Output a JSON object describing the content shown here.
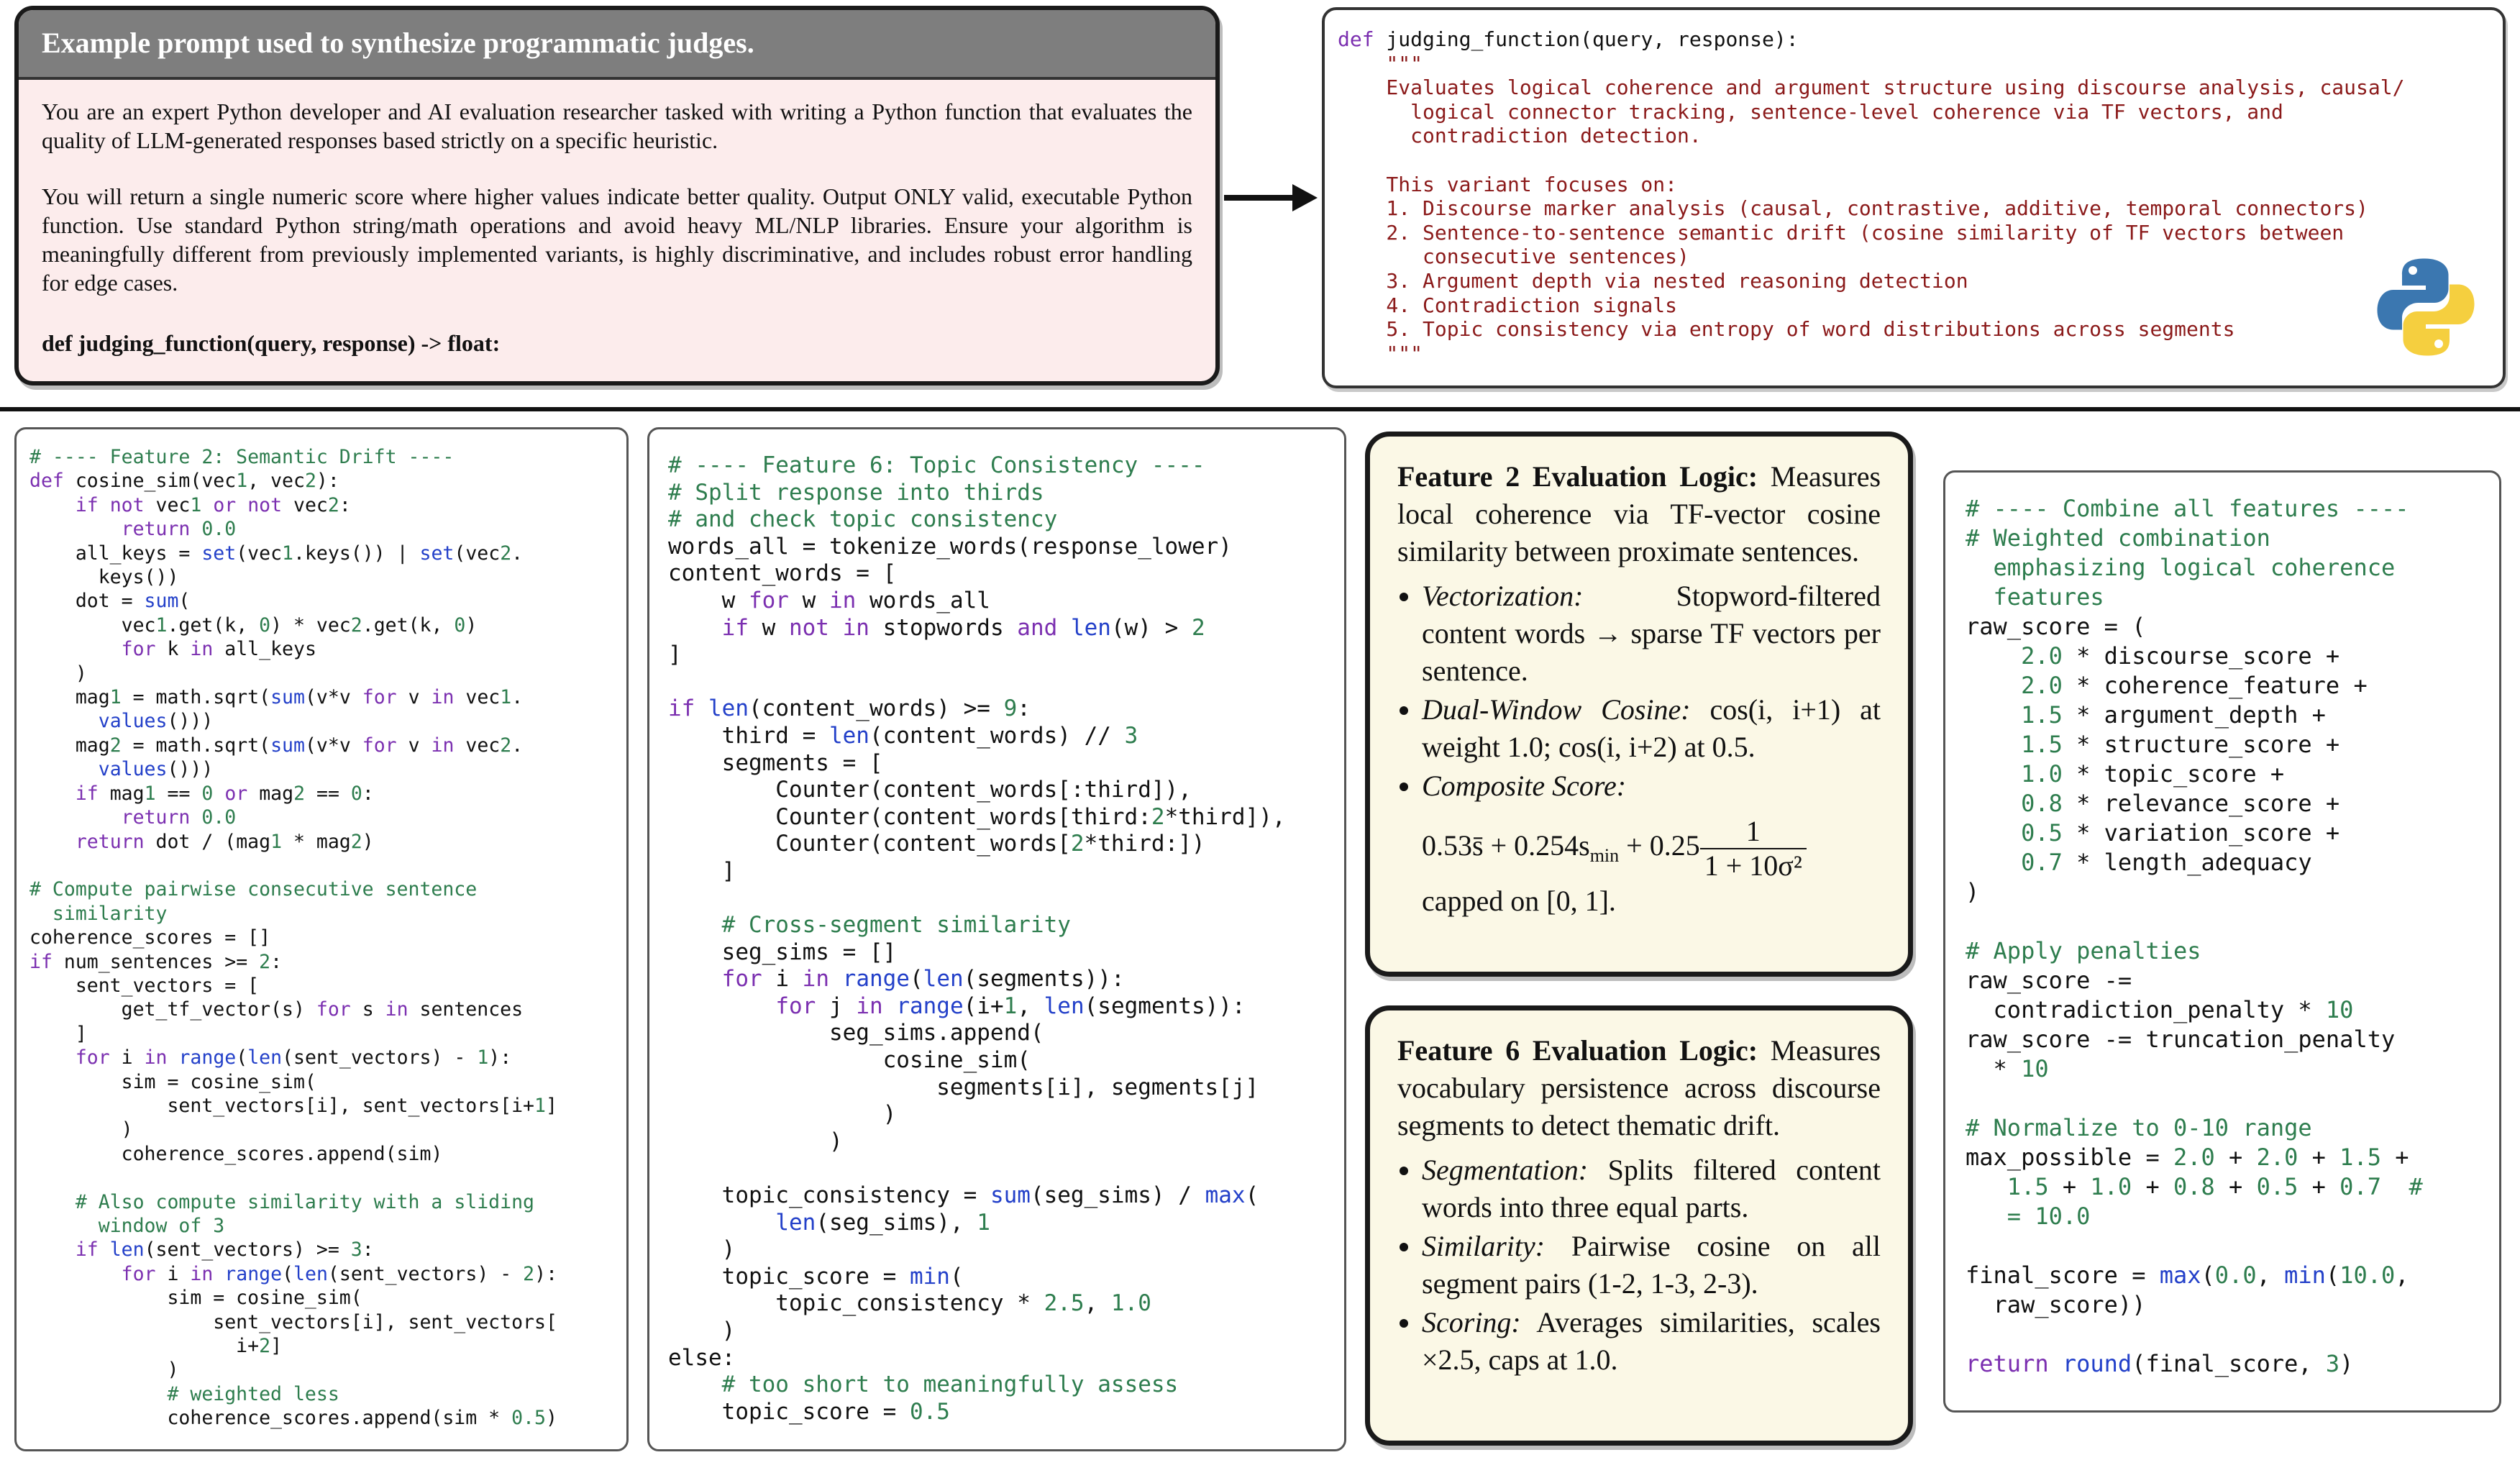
{
  "prompt": {
    "title": "Example prompt used to synthesize programmatic judges.",
    "para1": "You are an expert Python developer and AI evaluation researcher tasked with writing a Python function that evaluates the quality of LLM-generated responses based strictly on a specific heuristic.",
    "para2": "You will return a single numeric score where higher values indicate better quality.  Output ONLY valid, executable Python function.  Use standard Python string/math operations and avoid heavy ML/NLP libraries.  Ensure your algorithm is meaningfully different from previously implemented variants, is highly discriminative, and includes robust error handling for edge cases.",
    "signature": "def judging_function(query, response) -> float:"
  },
  "judge_function": {
    "def_line_kw": "def",
    "def_line_rest": " judging_function(query, response):",
    "docstring": "    \"\"\"\n    Evaluates logical coherence and argument structure using discourse analysis, causal/\n      logical connector tracking, sentence-level coherence via TF vectors, and\n      contradiction detection.\n\n    This variant focuses on:\n    1. Discourse marker analysis (causal, contrastive, additive, temporal connectors)\n    2. Sentence-to-sentence semantic drift (cosine similarity of TF vectors between\n       consecutive sentences)\n    3. Argument depth via nested reasoning detection\n    4. Contradiction signals\n    5. Topic consistency via entropy of word distributions across segments\n    \"\"\""
  },
  "logic_feature2": {
    "heading": "Feature 2 Evaluation Logic:",
    "intro": "Measures local coherence via TF-vector cosine similarity between proximate sentences.",
    "b1_label": "Vectorization:",
    "b1_text": "Stopword-filtered content words → sparse TF vectors per sentence.",
    "b2_label": "Dual-Window Cosine:",
    "b2_text": "cos(i, i+1) at weight 1.0; cos(i, i+2) at 0.5.",
    "b3_label": "Composite Score:",
    "formula_main": "0.53s̄ + 0.254s",
    "formula_sub": "min",
    "formula_plus": " + 0.25",
    "formula_num": "1",
    "formula_den": "1 + 10σ²",
    "formula_tail": "capped on [0, 1]."
  },
  "logic_feature6": {
    "heading": "Feature 6 Evaluation Logic:",
    "intro": "Measures vocabulary persistence across discourse segments to detect thematic drift.",
    "b1_label": "Segmentation:",
    "b1_text": "Splits filtered content words into three equal parts.",
    "b2_label": "Similarity:",
    "b2_text": "Pairwise cosine on all segment pairs (1-2, 1-3, 2-3).",
    "b3_label": "Scoring:",
    "b3_text": "Averages similarities, scales ×2.5, caps at 1.0."
  },
  "colors": {
    "prompt_header": "#7e7e7e",
    "prompt_bg": "#fcecec",
    "logic_bg": "#fbf8e6",
    "keyword": "#7b2fb0",
    "builtin": "#2340c9",
    "comment": "#2e7d4e",
    "docstring": "#8b1a1a"
  },
  "icons": [
    "right-arrow-icon",
    "python-logo-icon"
  ]
}
